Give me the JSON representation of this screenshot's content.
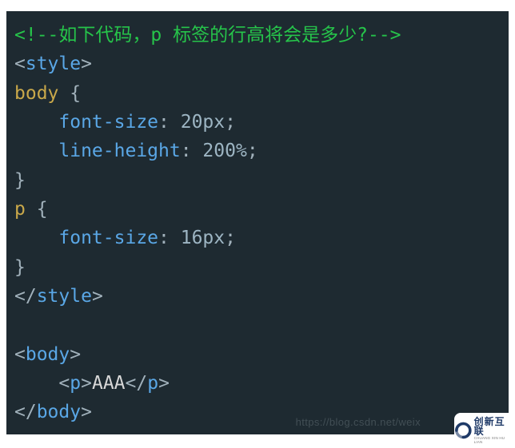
{
  "code": {
    "comment_open": "<!--",
    "comment_text": "如下代码，p 标签的行高将会是多少?",
    "comment_close": "-->",
    "style_open_lt": "<",
    "style_open_name": "style",
    "style_open_gt": ">",
    "selector_body": "body",
    "brace_open": " {",
    "indent_prop1": "    font-size",
    "colon_sep": ": ",
    "value_fs_body": "20px",
    "semicolon": ";",
    "indent_prop2": "    line-height",
    "value_lh_body": "200%",
    "brace_close": "}",
    "selector_p": "p",
    "value_fs_p": "16px",
    "style_close_lt": "</",
    "style_close_gt": ">",
    "body_open_lt": "<",
    "body_open_name": "body",
    "body_open_gt": ">",
    "p_indent": "    ",
    "p_open_lt": "<",
    "p_name": "p",
    "p_open_gt": ">",
    "p_content": "AAA",
    "p_close_lt": "</",
    "p_close_gt": ">",
    "body_close_lt": "</",
    "body_close_gt": ">"
  },
  "watermark": {
    "url": "https://blog.csdn.net/weix",
    "brand_cn": "创新互联",
    "brand_en": "CHUANG XIN HU LIAN"
  }
}
